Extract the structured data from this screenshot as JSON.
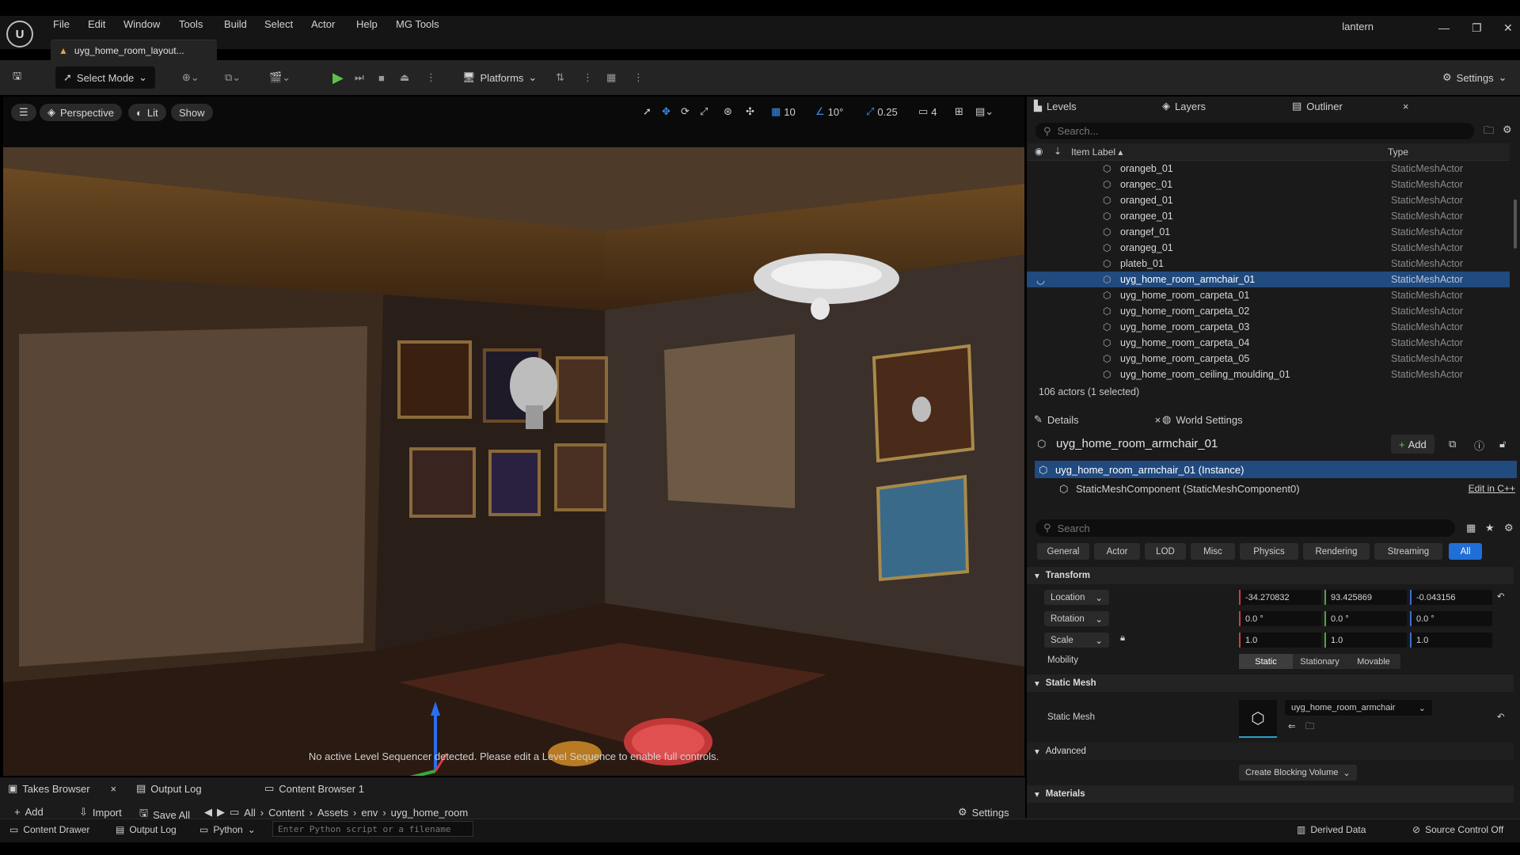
{
  "app": {
    "menu": [
      "File",
      "Edit",
      "Window",
      "Tools",
      "Build",
      "Select",
      "Actor",
      "Help",
      "MG Tools"
    ],
    "project_name": "lantern",
    "document_tab": "uyg_home_room_layout..."
  },
  "toolbar": {
    "select_mode": "Select Mode",
    "platforms": "Platforms",
    "settings": "Settings"
  },
  "viewport": {
    "perspective": "Perspective",
    "lit": "Lit",
    "show": "Show",
    "grid_snap": "10",
    "rotation_snap": "10°",
    "scale_snap": "0.25",
    "camera_speed": "4",
    "sequencer_message": "No active Level Sequencer detected. Please edit a Level Sequence to enable full controls."
  },
  "bottom": {
    "tabs": [
      "Takes Browser",
      "Output Log",
      "Content Browser 1"
    ],
    "content_browser": {
      "buttons": [
        "Add",
        "Import",
        "Save All"
      ],
      "path": [
        "All",
        "Content",
        "Assets",
        "env",
        "uyg_home_room"
      ],
      "settings": "Settings"
    },
    "status": {
      "content_drawer": "Content Drawer",
      "output_log": "Output Log",
      "python": "Python",
      "python_placeholder": "Enter Python script or a filename",
      "derived_data": "Derived Data",
      "source_control": "Source Control Off"
    }
  },
  "outliner": {
    "tabs": [
      "Levels",
      "Layers",
      "Outliner"
    ],
    "search_placeholder": "Search...",
    "col_label": "Item Label",
    "col_type": "Type",
    "rows": [
      {
        "label": "orangeb_01",
        "type": "StaticMeshActor"
      },
      {
        "label": "orangec_01",
        "type": "StaticMeshActor"
      },
      {
        "label": "oranged_01",
        "type": "StaticMeshActor"
      },
      {
        "label": "orangee_01",
        "type": "StaticMeshActor"
      },
      {
        "label": "orangef_01",
        "type": "StaticMeshActor"
      },
      {
        "label": "orangeg_01",
        "type": "StaticMeshActor"
      },
      {
        "label": "plateb_01",
        "type": "StaticMeshActor"
      },
      {
        "label": "uyg_home_room_armchair_01",
        "type": "StaticMeshActor"
      },
      {
        "label": "uyg_home_room_carpeta_01",
        "type": "StaticMeshActor"
      },
      {
        "label": "uyg_home_room_carpeta_02",
        "type": "StaticMeshActor"
      },
      {
        "label": "uyg_home_room_carpeta_03",
        "type": "StaticMeshActor"
      },
      {
        "label": "uyg_home_room_carpeta_04",
        "type": "StaticMeshActor"
      },
      {
        "label": "uyg_home_room_carpeta_05",
        "type": "StaticMeshActor"
      },
      {
        "label": "uyg_home_room_ceiling_moulding_01",
        "type": "StaticMeshActor"
      }
    ],
    "actor_count": "106 actors (1 selected)"
  },
  "details": {
    "tabs": [
      "Details",
      "World Settings"
    ],
    "actor_name": "uyg_home_room_armchair_01",
    "add_label": "Add",
    "instance_label": "uyg_home_room_armchair_01 (Instance)",
    "component_label": "StaticMeshComponent (StaticMeshComponent0)",
    "edit_cpp": "Edit in C++",
    "search_placeholder": "Search",
    "categories": [
      "General",
      "Actor",
      "LOD",
      "Misc",
      "Physics",
      "Rendering",
      "Streaming",
      "All"
    ],
    "transform": {
      "section": "Transform",
      "location_label": "Location",
      "rotation_label": "Rotation",
      "scale_label": "Scale",
      "location": [
        "-34.270832",
        "93.425869",
        "-0.043156"
      ],
      "rotation": [
        "0.0 °",
        "0.0 °",
        "0.0 °"
      ],
      "scale": [
        "1.0",
        "1.0",
        "1.0"
      ],
      "mobility_label": "Mobility",
      "mobility": [
        "Static",
        "Stationary",
        "Movable"
      ]
    },
    "static_mesh": {
      "section": "Static Mesh",
      "label": "Static Mesh",
      "value": "uyg_home_room_armchair"
    },
    "advanced": {
      "section": "Advanced",
      "button": "Create Blocking Volume"
    },
    "materials": {
      "section": "Materials"
    }
  }
}
